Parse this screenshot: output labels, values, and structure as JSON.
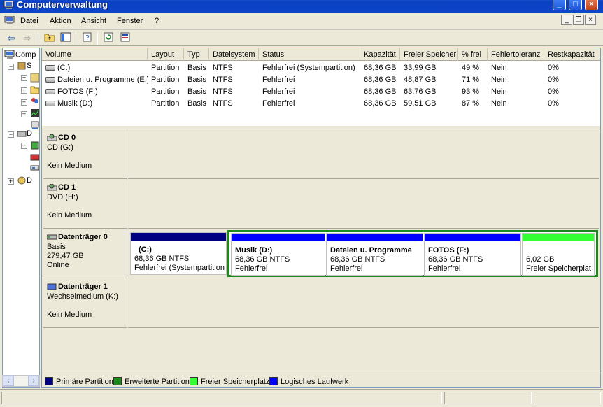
{
  "window": {
    "title": "Computerverwaltung"
  },
  "menu": {
    "items": [
      "Datei",
      "Aktion",
      "Ansicht",
      "Fenster",
      "?"
    ]
  },
  "tree": {
    "root_label": "Comp",
    "nodes": [
      "S",
      "D",
      "D"
    ]
  },
  "volume_list": {
    "columns": [
      "Volume",
      "Layout",
      "Typ",
      "Dateisystem",
      "Status",
      "Kapazität",
      "Freier Speicher",
      "% frei",
      "Fehlertoleranz",
      "Restkapazität"
    ],
    "rows": [
      [
        "(C:)",
        "Partition",
        "Basis",
        "NTFS",
        "Fehlerfrei (Systempartition)",
        "68,36 GB",
        "33,99 GB",
        "49 %",
        "Nein",
        "0%"
      ],
      [
        "Dateien u. Programme (E:)",
        "Partition",
        "Basis",
        "NTFS",
        "Fehlerfrei",
        "68,36 GB",
        "48,87 GB",
        "71 %",
        "Nein",
        "0%"
      ],
      [
        "FOTOS (F:)",
        "Partition",
        "Basis",
        "NTFS",
        "Fehlerfrei",
        "68,36 GB",
        "63,76 GB",
        "93 %",
        "Nein",
        "0%"
      ],
      [
        "Musik  (D:)",
        "Partition",
        "Basis",
        "NTFS",
        "Fehlerfrei",
        "68,36 GB",
        "59,51 GB",
        "87 %",
        "Nein",
        "0%"
      ]
    ]
  },
  "disks": [
    {
      "name": "CD 0",
      "line1": "CD (G:)",
      "line2": "",
      "line3": "Kein Medium"
    },
    {
      "name": "CD 1",
      "line1": "DVD (H:)",
      "line2": "",
      "line3": "Kein Medium"
    },
    {
      "name": "Datenträger 0",
      "line1": "Basis",
      "line2": "279,47 GB",
      "line3": "Online"
    },
    {
      "name": "Datenträger 1",
      "line1": "Wechselmedium (K:)",
      "line2": "",
      "line3": "Kein Medium"
    }
  ],
  "partitions": [
    {
      "name": "(C:)",
      "size": "68,36 GB NTFS",
      "status": "Fehlerfrei (Systempartition",
      "color": "#000080"
    },
    {
      "name": "Musik  (D:)",
      "size": "68,36 GB NTFS",
      "status": "Fehlerfrei",
      "color": "#0000ff"
    },
    {
      "name": "Dateien u. Programme",
      "size": "68,36 GB NTFS",
      "status": "Fehlerfrei",
      "color": "#0000ff"
    },
    {
      "name": "FOTOS  (F:)",
      "size": "68,36 GB NTFS",
      "status": "Fehlerfrei",
      "color": "#0000ff"
    },
    {
      "name": "",
      "size": "6,02 GB",
      "status": "Freier Speicherplat",
      "color": "#33ff33"
    }
  ],
  "legend": [
    {
      "label": "Primäre Partition",
      "color": "#000080"
    },
    {
      "label": "Erweiterte Partition",
      "color": "#1a8a1a"
    },
    {
      "label": "Freier Speicherplatz",
      "color": "#33ff33"
    },
    {
      "label": "Logisches Laufwerk",
      "color": "#0000ff"
    }
  ],
  "icons": {
    "toolbar": [
      "back-arrow-icon",
      "forward-arrow-icon",
      "up-folder-icon",
      "show-tree-icon",
      "properties-icon",
      "refresh-icon",
      "export-icon"
    ]
  }
}
